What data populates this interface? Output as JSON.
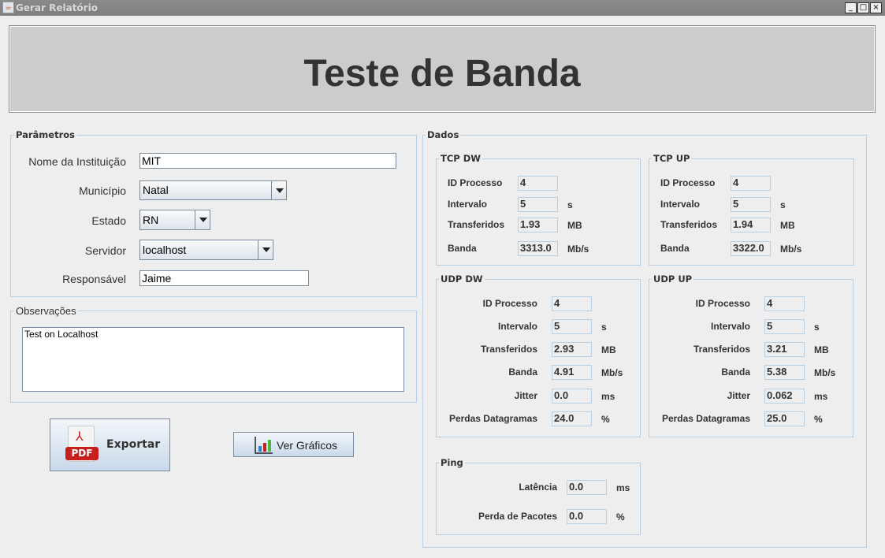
{
  "window": {
    "title": "Gerar Relatório",
    "controls": [
      "_",
      "□",
      "×"
    ]
  },
  "banner": {
    "title": "Teste de Banda"
  },
  "parametros": {
    "legend": "Parâmetros",
    "nome_label": "Nome da Instituição",
    "nome_value": "MIT",
    "municipio_label": "Município",
    "municipio_value": "Natal",
    "estado_label": "Estado",
    "estado_value": "RN",
    "servidor_label": "Servidor",
    "servidor_value": "localhost",
    "responsavel_label": "Responsável",
    "responsavel_value": "Jaime"
  },
  "observacoes": {
    "legend": "Observações",
    "value": "Test on Localhost"
  },
  "buttons": {
    "exportar": "Exportar",
    "pdf_icon_text": "PDF",
    "ver_graficos": "Ver Gráficos"
  },
  "dados": {
    "legend": "Dados",
    "tcp_dw": {
      "legend": "TCP DW",
      "rows": [
        {
          "label": "ID Processo",
          "value": "4",
          "unit": ""
        },
        {
          "label": "Intervalo",
          "value": "5",
          "unit": "s"
        },
        {
          "label": "Transferidos",
          "value": "1.93",
          "unit": "MB"
        },
        {
          "label": "Banda",
          "value": "3313.0",
          "unit": "Mb/s"
        }
      ]
    },
    "tcp_up": {
      "legend": "TCP UP",
      "rows": [
        {
          "label": "ID Processo",
          "value": "4",
          "unit": ""
        },
        {
          "label": "Intervalo",
          "value": "5",
          "unit": "s"
        },
        {
          "label": "Transferidos",
          "value": "1.94",
          "unit": "MB"
        },
        {
          "label": "Banda",
          "value": "3322.0",
          "unit": "Mb/s"
        }
      ]
    },
    "udp_dw": {
      "legend": "UDP DW",
      "rows": [
        {
          "label": "ID Processo",
          "value": "4",
          "unit": ""
        },
        {
          "label": "Intervalo",
          "value": "5",
          "unit": "s"
        },
        {
          "label": "Transferidos",
          "value": "2.93",
          "unit": "MB"
        },
        {
          "label": "Banda",
          "value": "4.91",
          "unit": "Mb/s"
        },
        {
          "label": "Jitter",
          "value": "0.0",
          "unit": "ms"
        },
        {
          "label": "Perdas Datagramas",
          "value": "24.0",
          "unit": "%"
        }
      ]
    },
    "udp_up": {
      "legend": "UDP UP",
      "rows": [
        {
          "label": "ID Processo",
          "value": "4",
          "unit": ""
        },
        {
          "label": "Intervalo",
          "value": "5",
          "unit": "s"
        },
        {
          "label": "Transferidos",
          "value": "3.21",
          "unit": "MB"
        },
        {
          "label": "Banda",
          "value": "5.38",
          "unit": "Mb/s"
        },
        {
          "label": "Jitter",
          "value": "0.062",
          "unit": "ms"
        },
        {
          "label": "Perdas Datagramas",
          "value": "25.0",
          "unit": "%"
        }
      ]
    },
    "ping": {
      "legend": "Ping",
      "rows": [
        {
          "label": "Latência",
          "value": "0.0",
          "unit": "ms"
        },
        {
          "label": "Perda de Pacotes",
          "value": "0.0",
          "unit": "%"
        }
      ]
    }
  }
}
